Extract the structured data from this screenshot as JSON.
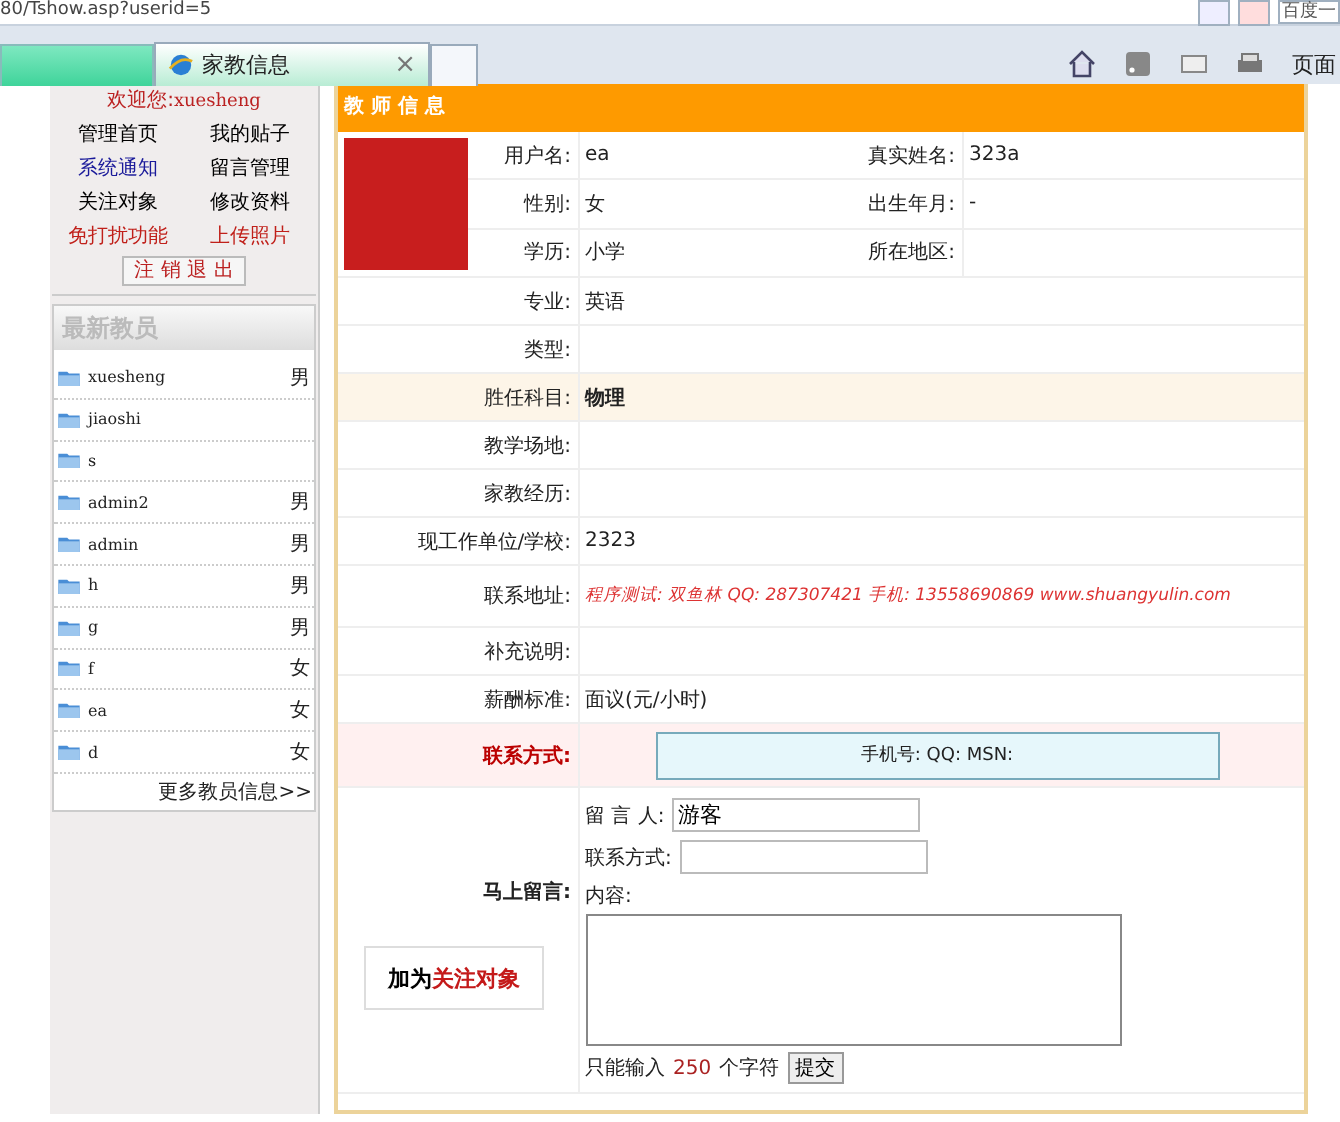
{
  "browser": {
    "address": "80/Tshow.asp?userid=5",
    "tab": {
      "label": "家教信息",
      "selected": true
    },
    "tab_close": "×",
    "search_partial": "百度一",
    "toolbar_partial": "页面"
  },
  "sidebar": {
    "welcome_label": "欢迎您:",
    "welcome_user": "xuesheng",
    "menu": [
      {
        "label": "管理首页",
        "color": "#000000"
      },
      {
        "label": "我的贴子",
        "color": "#000000"
      },
      {
        "label": "系统通知",
        "color": "#1a1a9a"
      },
      {
        "label": "留言管理",
        "color": "#000000"
      },
      {
        "label": "关注对象",
        "color": "#000000"
      },
      {
        "label": "修改资料",
        "color": "#000000"
      },
      {
        "label": "免打扰功能",
        "color": "#c0201a"
      },
      {
        "label": "上传照片",
        "color": "#c0201a"
      }
    ],
    "logout": "注 销 退 出",
    "teachers_title": "最新教员",
    "teachers": [
      {
        "name": "xuesheng",
        "gender": "男"
      },
      {
        "name": "jiaoshi"
      },
      {
        "name": "s"
      },
      {
        "name": "admin2",
        "gender": "男"
      },
      {
        "name": "admin",
        "gender": "男"
      },
      {
        "name": "h",
        "gender": "男"
      },
      {
        "name": "g",
        "gender": "男"
      },
      {
        "name": "f",
        "gender": "女"
      },
      {
        "name": "ea",
        "gender": "女"
      },
      {
        "name": "d",
        "gender": "女"
      }
    ],
    "more": "更多教员信息>>"
  },
  "panel": {
    "title": "教 师 信 息",
    "rows": [
      {
        "kind": "pair",
        "label": "用户名:",
        "value": "ea",
        "label2": "真实姓名:",
        "value2": "323a"
      },
      {
        "kind": "pair",
        "label": "性别:",
        "value": "女",
        "label2": "出生年月:",
        "value2": "-"
      },
      {
        "kind": "pair",
        "label": "学历:",
        "value": "小学",
        "label2": "所在地区:"
      },
      {
        "kind": "full",
        "label": "专业:",
        "value": "英语"
      },
      {
        "kind": "full",
        "label": "类型:"
      },
      {
        "kind": "full",
        "label": "胜任科目:",
        "value": "物理",
        "highlighted": true
      },
      {
        "kind": "full",
        "label": "教学场地:"
      },
      {
        "kind": "full",
        "label": "家教经历:"
      },
      {
        "kind": "full",
        "label": "现工作单位/学校:",
        "value": "2323"
      },
      {
        "kind": "note",
        "label": "联系地址:",
        "value": "程序测试: 双鱼林  QQ: 287307421  手机: 13558690869  www.shuangyulin.com"
      },
      {
        "kind": "full",
        "label": "补充说明:"
      },
      {
        "kind": "full",
        "label": "薪酬标准:",
        "value": "面议(元/小时)"
      },
      {
        "kind": "contact",
        "label": "联系方式:",
        "value": "手机号:   QQ:   MSN:"
      }
    ],
    "message": {
      "label": "马上留言:",
      "follow_prefix": "加为",
      "follow_highlight": "关注对象",
      "author_label": "留 言 人:",
      "author_value": "游客",
      "contact_label": "联系方式:",
      "content_label": "内容:",
      "limit_prefix": "只能输入",
      "limit_count": "250",
      "limit_suffix": "个字符",
      "submit": "提交"
    }
  }
}
